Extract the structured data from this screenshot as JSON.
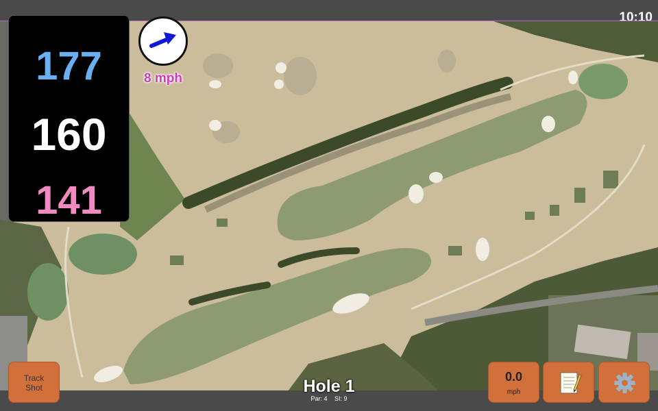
{
  "clock": "10:10",
  "yardage": {
    "back": "177",
    "middle": "160",
    "front": "141"
  },
  "wind": {
    "speed_label": "8 mph",
    "icon": "arrow-right-icon"
  },
  "hole": {
    "title": "Hole 1",
    "par": "Par: 4",
    "si": "SI: 9"
  },
  "buttons": {
    "track_line1": "Track",
    "track_line2": "Shot",
    "speed_value": "0.0",
    "speed_unit": "mph",
    "notes_icon": "notepad-icon",
    "settings_icon": "gear-icon"
  },
  "colors": {
    "back": "#6ab0f0",
    "middle": "#ffffff",
    "front": "#f08ac0",
    "wind_label": "#d23cc0",
    "button": "#d2703b"
  }
}
